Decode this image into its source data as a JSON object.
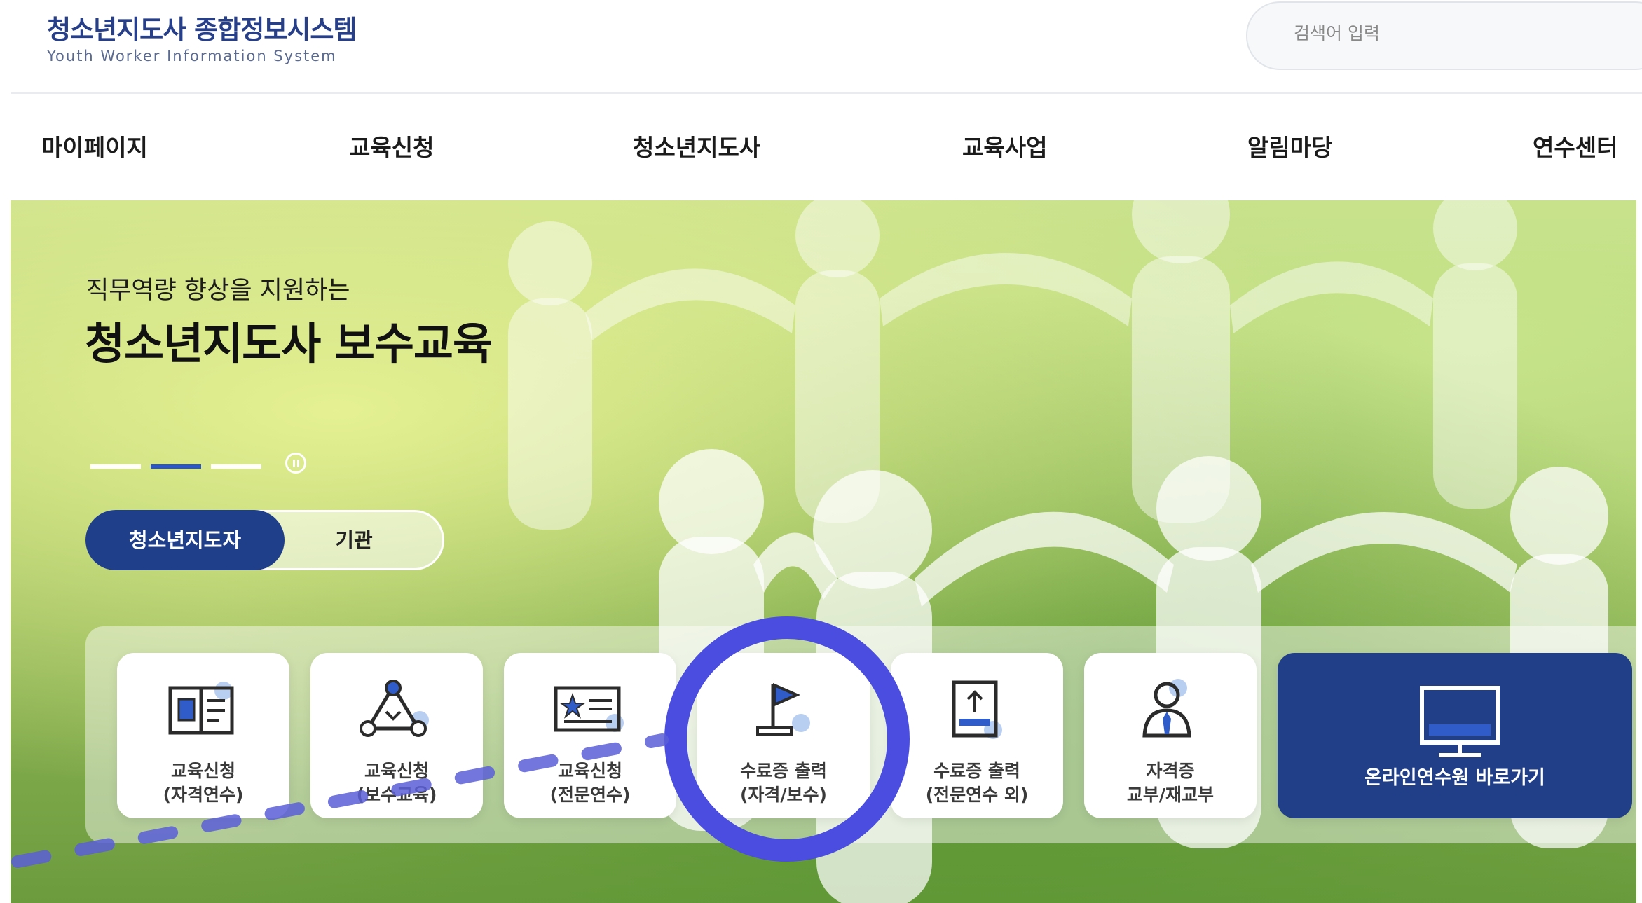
{
  "header": {
    "logo_title": "청소년지도사 종합정보시스템",
    "logo_subtitle": "Youth Worker Information System",
    "search_placeholder": "검색어 입력"
  },
  "nav": {
    "items": [
      {
        "label": "마이페이지"
      },
      {
        "label": "교육신청"
      },
      {
        "label": "청소년지도사"
      },
      {
        "label": "교육사업"
      },
      {
        "label": "알림마당"
      },
      {
        "label": "연수센터"
      }
    ]
  },
  "hero": {
    "subtitle": "직무역량 향상을 지원하는",
    "title": "청소년지도사 보수교육",
    "slides_total": 3,
    "slides_active": 2
  },
  "toggle": {
    "active_label": "청소년지도자",
    "inactive_label": "기관"
  },
  "quick_menu": [
    {
      "icon": "document-icon",
      "line1": "교육신청",
      "line2": "(자격연수)"
    },
    {
      "icon": "network-icon",
      "line1": "교육신청",
      "line2": "(보수교육)"
    },
    {
      "icon": "certificate-icon",
      "line1": "교육신청",
      "line2": "(전문연수)"
    },
    {
      "icon": "flag-icon",
      "line1": "수료증 출력",
      "line2": "(자격/보수)"
    },
    {
      "icon": "upload-document-icon",
      "line1": "수료증 출력",
      "line2": "(전문연수 외)"
    },
    {
      "icon": "person-icon",
      "line1": "자격증",
      "line2": "교부/재교부"
    },
    {
      "icon": "monitor-icon",
      "line1": "온라인연수원 바로가기"
    }
  ],
  "colors": {
    "brand_navy": "#213f89",
    "highlight_ring": "#4a4de0",
    "indicator_active": "#2a55cc"
  }
}
